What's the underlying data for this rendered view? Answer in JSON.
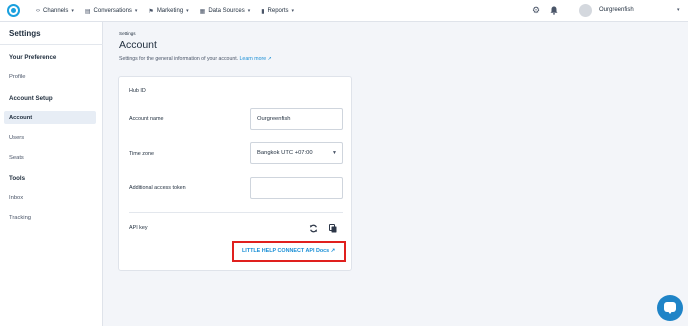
{
  "topbar": {
    "nav": [
      {
        "icon": "code-brackets-icon",
        "glyph": "‹›",
        "label": "Channels"
      },
      {
        "icon": "chat-icon",
        "glyph": "▤",
        "label": "Conversations"
      },
      {
        "icon": "megaphone-icon",
        "glyph": "⚑",
        "label": "Marketing"
      },
      {
        "icon": "database-icon",
        "glyph": "▦",
        "label": "Data Sources"
      },
      {
        "icon": "bar-chart-icon",
        "glyph": "▮",
        "label": "Reports"
      }
    ],
    "user_name": "Ourgreenfish"
  },
  "sidebar": {
    "title": "Settings",
    "sections": [
      {
        "label": "Your Preference",
        "items": [
          "Profile"
        ]
      },
      {
        "label": "Account Setup",
        "items": [
          "Account",
          "Users",
          "Seats"
        ]
      },
      {
        "label": "Tools",
        "items": [
          "Inbox",
          "Tracking"
        ]
      }
    ],
    "active_item": "Account"
  },
  "main": {
    "breadcrumb": "Settings",
    "title": "Account",
    "subtitle": "Settings for the general information of your account.",
    "learn_more": "Learn more",
    "card": {
      "hub_id_label": "Hub ID",
      "account_name_label": "Account name",
      "account_name_value": "Ourgreenfish",
      "time_zone_label": "Time zone",
      "time_zone_value": "Bangkok UTC +07:00",
      "access_token_label": "Additional access token",
      "access_token_value": "",
      "api_key_label": "API key",
      "docs_link": "LITTLE HELP CONNECT API Docs"
    }
  },
  "colors": {
    "accent": "#1a8fd6",
    "highlight_border": "#e0201e",
    "chat_bubble": "#1f84c7"
  }
}
